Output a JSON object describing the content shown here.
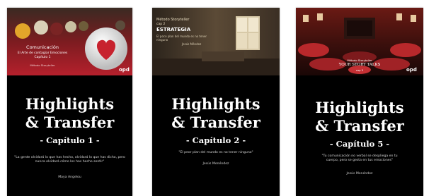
{
  "books": [
    {
      "cover": {
        "title": "Comunicación",
        "subtitle": "El Arte de contagiar Emociones",
        "part": "Capítulo 1",
        "series": "Método Storyteller",
        "brand": "opd",
        "palette": {
          "top": "#2b1f1c",
          "band": "#b5202c",
          "heart": "#c7222e"
        }
      },
      "highlights_line1": "Highlights",
      "highlights_line2": "& Transfer",
      "chapter": "- Capítulo 1 -",
      "quote": "\"La gente olvidará lo que has hecho, olvidará lo que has dicho, pero nunca olvidará cómo les has hecho sentir\"",
      "author": "Maya Angelou"
    },
    {
      "cover": {
        "series": "Método Storyteller",
        "part": "cap 2",
        "title": "ESTRATEGIA",
        "subtitle": "El poco plan del mundo es no tener ninguno",
        "author": "Jesús Méndez",
        "palette": {
          "top": "#4a3a2a",
          "light": "#c9b99a"
        }
      },
      "highlights_line1": "Highlights",
      "highlights_line2": "& Transfer",
      "chapter": "- Capítulo 2 -",
      "quote": "\"El peor plan del mundo es no tener ninguno\"",
      "author": "Jesús Menéndez"
    },
    {
      "cover": {
        "series": "Método Storyteller",
        "title": "YOUR STORY TALKS",
        "part": "cap 5",
        "brand": "opd",
        "palette": {
          "top": "#5a1410",
          "seats": "#b8282b"
        }
      },
      "highlights_line1": "Highlights",
      "highlights_line2": "& Transfer",
      "chapter": "- Capítulo 5 -",
      "quote": "\"Tu comunicación no verbal se despliega en tu cuerpo, pero se gesta en tus emociones\"",
      "author": "Jesús Menéndez"
    }
  ]
}
